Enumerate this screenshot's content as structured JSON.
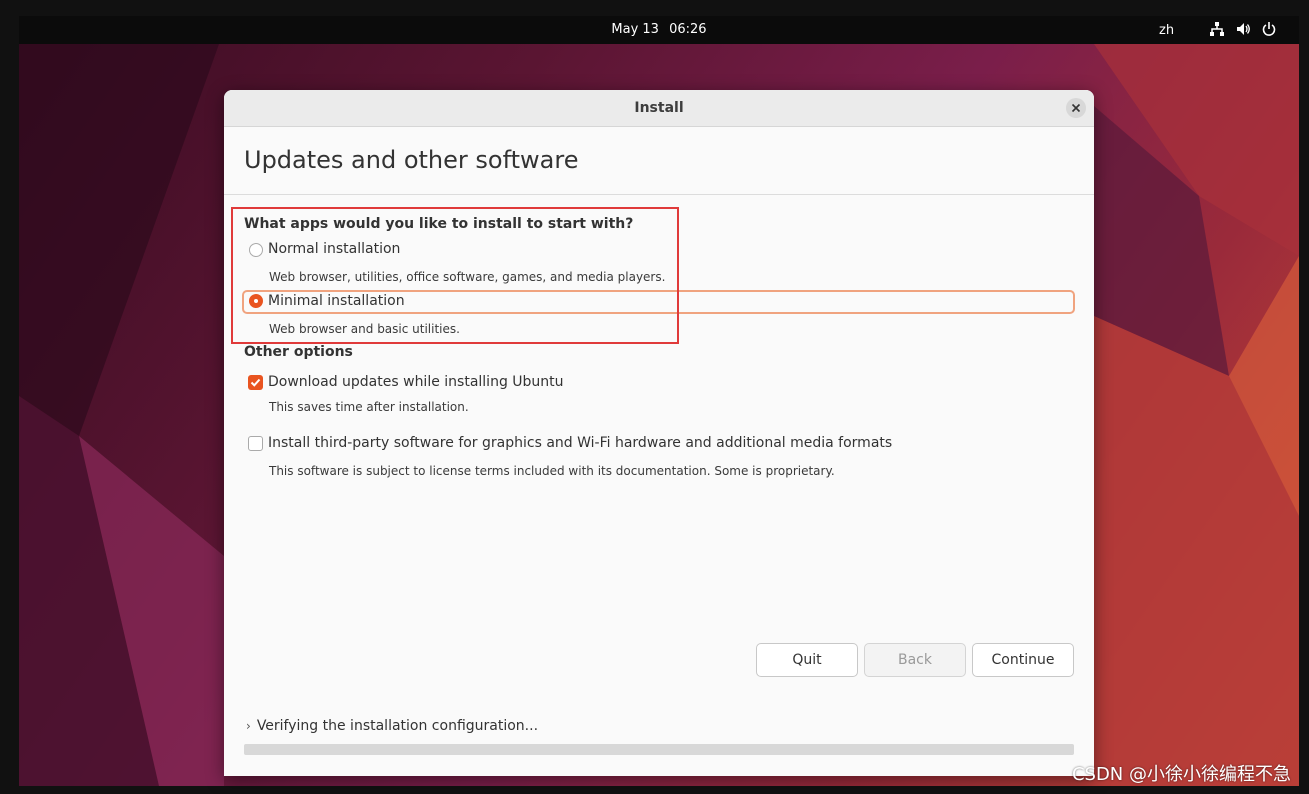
{
  "topbar": {
    "date": "May 13",
    "time": "06:26",
    "language": "zh"
  },
  "window": {
    "title": "Install",
    "page_title": "Updates and other software"
  },
  "install_question": "What apps would you like to install to start with?",
  "install_options": [
    {
      "label": "Normal installation",
      "description": "Web browser, utilities, office software, games, and media players.",
      "selected": false
    },
    {
      "label": "Minimal installation",
      "description": "Web browser and basic utilities.",
      "selected": true
    }
  ],
  "other_options_heading": "Other options",
  "other_options": [
    {
      "label": "Download updates while installing Ubuntu",
      "description": "This saves time after installation.",
      "checked": true
    },
    {
      "label": "Install third-party software for graphics and Wi-Fi hardware and additional media formats",
      "description": "This software is subject to license terms included with its documentation. Some is proprietary.",
      "checked": false
    }
  ],
  "buttons": {
    "quit": "Quit",
    "back": "Back",
    "continue": "Continue"
  },
  "status": {
    "text": "Verifying the installation configuration...",
    "progress": 0
  },
  "watermark": "CSDN @小徐小徐编程不急",
  "colors": {
    "accent": "#E95420",
    "annotation_box": "#E03A3A"
  },
  "icons": [
    "network-icon",
    "volume-icon",
    "power-icon",
    "close-icon",
    "chevron-right-icon"
  ]
}
